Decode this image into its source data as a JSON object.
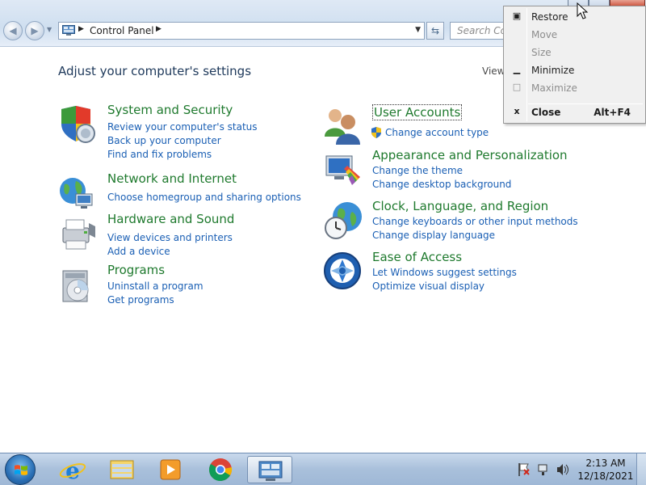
{
  "address_bar": {
    "breadcrumb": "Control Panel",
    "search_placeholder": "Search Con"
  },
  "content": {
    "heading": "Adjust your computer's settings",
    "view_by": "View"
  },
  "categories_left": [
    {
      "title": "System and Security",
      "links": [
        "Review your computer's status",
        "Back up your computer",
        "Find and fix problems"
      ],
      "icon": "shield-icon"
    },
    {
      "title": "Network and Internet",
      "links": [
        "Choose homegroup and sharing options"
      ],
      "icon": "network-globe-icon"
    },
    {
      "title": "Hardware and Sound",
      "links": [
        "View devices and printers",
        "Add a device"
      ],
      "icon": "printer-icon"
    },
    {
      "title": "Programs",
      "links": [
        "Uninstall a program",
        "Get programs"
      ],
      "icon": "programs-disc-icon"
    }
  ],
  "categories_right": [
    {
      "title": "User Accounts",
      "links": [
        "Change account type"
      ],
      "icon": "users-icon"
    },
    {
      "title": "Appearance and Personalization",
      "links": [
        "Change the theme",
        "Change desktop background"
      ],
      "icon": "monitor-paint-icon"
    },
    {
      "title": "Clock, Language, and Region",
      "links": [
        "Change keyboards or other input methods",
        "Change display language"
      ],
      "icon": "clock-globe-icon"
    },
    {
      "title": "Ease of Access",
      "links": [
        "Let Windows suggest settings",
        "Optimize visual display"
      ],
      "icon": "ease-of-access-icon"
    }
  ],
  "context_menu": {
    "items": [
      {
        "label": "Restore",
        "enabled": true
      },
      {
        "label": "Move",
        "enabled": false
      },
      {
        "label": "Size",
        "enabled": false
      },
      {
        "label": "Minimize",
        "enabled": true
      },
      {
        "label": "Maximize",
        "enabled": false
      },
      {
        "label": "Close",
        "shortcut": "Alt+F4",
        "enabled": true
      }
    ]
  },
  "taskbar": {
    "pinned": [
      "internet-explorer-icon",
      "file-explorer-icon",
      "media-player-icon",
      "chrome-icon",
      "control-panel-icon"
    ],
    "clock_time": "2:13 AM",
    "clock_date": "12/18/2021"
  },
  "colors": {
    "category_title": "#1f7a2e",
    "link": "#1a5fb4",
    "heading": "#1e395b"
  }
}
